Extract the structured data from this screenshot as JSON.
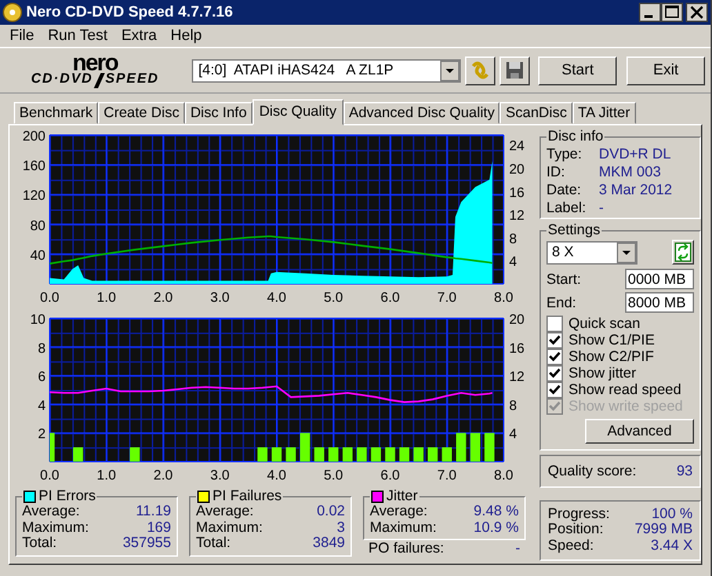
{
  "window": {
    "title": "Nero CD-DVD Speed 4.7.7.16"
  },
  "menu": [
    "File",
    "Run Test",
    "Extra",
    "Help"
  ],
  "logo": {
    "top": "nero",
    "left": "CD·DVD",
    "right": "SPEED"
  },
  "toolbar": {
    "drive": "[4:0]  ATAPI iHAS424   A ZL1P",
    "buttons": [
      "Start",
      "Exit"
    ]
  },
  "tabs": [
    {
      "label": "Benchmark",
      "selected": false
    },
    {
      "label": "Create Disc",
      "selected": false
    },
    {
      "label": "Disc Info",
      "selected": false
    },
    {
      "label": "Disc Quality",
      "selected": true
    },
    {
      "label": "Advanced Disc Quality",
      "selected": false
    },
    {
      "label": "ScanDisc",
      "selected": false
    },
    {
      "label": "TA Jitter",
      "selected": false
    }
  ],
  "charts": [
    {
      "chart_data": {
        "type": "area",
        "grid": true,
        "xlim": [
          0,
          8
        ],
        "ylim": [
          0,
          200
        ],
        "y2lim": [
          0,
          25.7
        ],
        "xticks": [
          {
            "value": 0,
            "label": "0.0"
          },
          {
            "value": 1,
            "label": "1.0"
          },
          {
            "value": 2,
            "label": "2.0"
          },
          {
            "value": 3,
            "label": "3.0"
          },
          {
            "value": 4,
            "label": "4.0"
          },
          {
            "value": 5,
            "label": "5.0"
          },
          {
            "value": 6,
            "label": "6.0"
          },
          {
            "value": 7,
            "label": "7.0"
          },
          {
            "value": 8,
            "label": "8.0"
          }
        ],
        "yticks": [
          40,
          80,
          120,
          160,
          200
        ],
        "y2ticks": [
          4,
          8,
          12,
          16,
          20,
          24
        ],
        "x": [
          0,
          0.25,
          0.4,
          0.5,
          0.6,
          0.75,
          1,
          1.5,
          2,
          2.5,
          3,
          3.5,
          3.85,
          3.9,
          4,
          4.5,
          5,
          5.5,
          6,
          6.5,
          7,
          7.1,
          7.15,
          7.25,
          7.5,
          7.75,
          7.8
        ],
        "series": [
          {
            "color": "#00ffff",
            "values": [
              8,
              6,
              20,
              25,
              8,
              4,
              4,
              4,
              4,
              4,
              4,
              4,
              4,
              14,
              16,
              14,
              12,
              11,
              10,
              9,
              10,
              12,
              90,
              110,
              130,
              140,
              165
            ]
          },
          {
            "color": "#00b000",
            "axis": "y2",
            "type": "line",
            "values": [
              3.5,
              3.9,
              4.1,
              4.3,
              4.5,
              4.8,
              5.2,
              5.9,
              6.5,
              7.1,
              7.6,
              8,
              8.2,
              8.2,
              8.1,
              7.7,
              7.2,
              6.6,
              6,
              5.3,
              4.6,
              4.5,
              4.4,
              4.3,
              4,
              3.7,
              3.6
            ]
          }
        ]
      }
    },
    {
      "chart_data": {
        "type": "bar",
        "grid": true,
        "xlim": [
          0,
          8
        ],
        "ylim": [
          0,
          10
        ],
        "y2lim": [
          0,
          20
        ],
        "xticks": [
          {
            "value": 0,
            "label": "0.0"
          },
          {
            "value": 1,
            "label": "1.0"
          },
          {
            "value": 2,
            "label": "2.0"
          },
          {
            "value": 3,
            "label": "3.0"
          },
          {
            "value": 4,
            "label": "4.0"
          },
          {
            "value": 5,
            "label": "5.0"
          },
          {
            "value": 6,
            "label": "6.0"
          },
          {
            "value": 7,
            "label": "7.0"
          },
          {
            "value": 8,
            "label": "8.0"
          }
        ],
        "yticks": [
          2,
          4,
          6,
          8,
          10
        ],
        "y2ticks": [
          4,
          8,
          12,
          16,
          20
        ],
        "x": [
          0,
          0.25,
          0.5,
          0.75,
          1,
          1.25,
          1.5,
          1.75,
          2,
          2.25,
          2.5,
          2.75,
          3,
          3.25,
          3.5,
          3.75,
          4,
          4.25,
          4.5,
          4.75,
          5,
          5.25,
          5.5,
          5.75,
          6,
          6.25,
          6.5,
          6.75,
          7,
          7.25,
          7.5,
          7.75,
          7.8
        ],
        "series": [
          {
            "color": "#66ff00",
            "values": [
              2,
              0,
              1,
              0,
              0,
              0,
              1,
              0,
              0,
              0,
              0,
              0,
              0,
              0,
              0,
              1,
              1,
              1,
              2,
              1,
              1,
              1,
              1,
              1,
              1,
              1,
              1,
              1,
              1,
              2,
              2,
              2,
              null
            ]
          },
          {
            "color": "#ff00ff",
            "axis": "y2",
            "type": "line",
            "values": [
              9.7,
              9.6,
              9.6,
              9.9,
              10.2,
              9.8,
              9.8,
              9.8,
              9.9,
              10.1,
              10.3,
              10.4,
              10.3,
              10.2,
              10.2,
              10.3,
              10.5,
              9.0,
              9.1,
              9.2,
              9.4,
              9.6,
              9.3,
              9.0,
              8.6,
              8.3,
              8.4,
              8.7,
              9.2,
              9.6,
              9.3,
              9.5,
              9.6
            ]
          }
        ]
      }
    }
  ],
  "disc_info": {
    "title": "Disc info",
    "rows": [
      {
        "label": "Type:",
        "value": "DVD+R DL"
      },
      {
        "label": "ID:",
        "value": "MKM 003"
      },
      {
        "label": "Date:",
        "value": "3 Mar 2012"
      },
      {
        "label": "Label:",
        "value": "-"
      }
    ]
  },
  "settings": {
    "title": "Settings",
    "speed": "8 X",
    "fields": [
      {
        "label": "Start:",
        "value": "0000 MB"
      },
      {
        "label": "End:",
        "value": "8000 MB"
      }
    ],
    "checkboxes": [
      {
        "label": "Quick scan",
        "checked": false,
        "disabled": false
      },
      {
        "label": "Show C1/PIE",
        "checked": true,
        "disabled": false
      },
      {
        "label": "Show C2/PIF",
        "checked": true,
        "disabled": false
      },
      {
        "label": "Show jitter",
        "checked": true,
        "disabled": false
      },
      {
        "label": "Show read speed",
        "checked": true,
        "disabled": false
      },
      {
        "label": "Show write speed",
        "checked": true,
        "disabled": true
      }
    ],
    "button": "Advanced"
  },
  "quality": {
    "label": "Quality score:",
    "value": "93"
  },
  "stats": [
    {
      "title": "PI Errors",
      "color": "#00ffff",
      "rows": [
        {
          "label": "Average:",
          "value": "11.19"
        },
        {
          "label": "Maximum:",
          "value": "169"
        },
        {
          "label": "Total:",
          "value": "357955"
        }
      ]
    },
    {
      "title": "PI Failures",
      "color": "#ffff00",
      "rows": [
        {
          "label": "Average:",
          "value": "0.02"
        },
        {
          "label": "Maximum:",
          "value": "3"
        },
        {
          "label": "Total:",
          "value": "3849"
        }
      ]
    },
    {
      "title": "Jitter",
      "color": "#ff00ff",
      "rows": [
        {
          "label": "Average:",
          "value": "9.48 %"
        },
        {
          "label": "Maximum:",
          "value": "10.9 %"
        }
      ]
    }
  ],
  "po_failures": {
    "label": "PO failures:",
    "value": "-"
  },
  "progress": [
    {
      "label": "Progress:",
      "value": "100 %"
    },
    {
      "label": "Position:",
      "value": "7999 MB"
    },
    {
      "label": "Speed:",
      "value": "3.44 X"
    }
  ]
}
